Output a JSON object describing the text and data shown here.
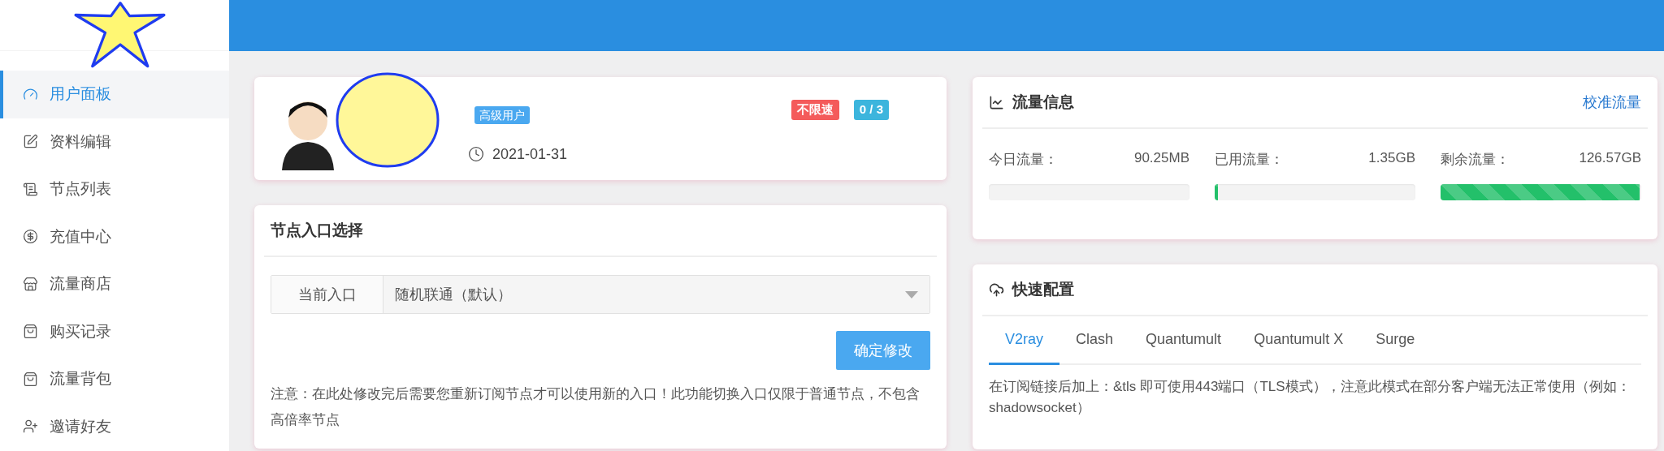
{
  "sidebar": {
    "items": [
      {
        "label": "用户面板",
        "selected": true
      },
      {
        "label": "资料编辑",
        "selected": false
      },
      {
        "label": "节点列表",
        "selected": false
      },
      {
        "label": "充值中心",
        "selected": false
      },
      {
        "label": "流量商店",
        "selected": false
      },
      {
        "label": "购买记录",
        "selected": false
      },
      {
        "label": "流量背包",
        "selected": false
      },
      {
        "label": "邀请好友",
        "selected": false
      }
    ]
  },
  "profile": {
    "badge": "高级用户",
    "date": "2021-01-31",
    "tags": [
      {
        "text": "不限速",
        "color": "#f45b5b"
      },
      {
        "text": "0 / 3",
        "color": "#3cb5dd"
      }
    ]
  },
  "entry_card": {
    "title": "节点入口选择",
    "field_label": "当前入口",
    "value": "随机联通（默认）",
    "button": "确定修改",
    "note": "注意：在此处修改完后需要您重新订阅节点才可以使用新的入口！此功能切换入口仅限于普通节点，不包含高倍率节点"
  },
  "traffic": {
    "title": "流量信息",
    "link": "校准流量",
    "meters": [
      {
        "label": "今日流量：",
        "reading": "90.25MB",
        "level": 0
      },
      {
        "label": "已用流量：",
        "reading": "1.35GB",
        "level": 0.01
      },
      {
        "label": "剩余流量：",
        "reading": "126.57GB",
        "level": 0.99
      }
    ]
  },
  "quick_config": {
    "title": "快速配置",
    "tabs": [
      {
        "label": "V2ray",
        "selected": true
      },
      {
        "label": "Clash",
        "selected": false
      },
      {
        "label": "Quantumult",
        "selected": false
      },
      {
        "label": "Quantumult X",
        "selected": false
      },
      {
        "label": "Surge",
        "selected": false
      }
    ],
    "note": "在订阅链接后加上：&tls 即可使用443端口（TLS模式），注意此模式在部分客户端无法正常使用（例如：shadowsocket）"
  }
}
